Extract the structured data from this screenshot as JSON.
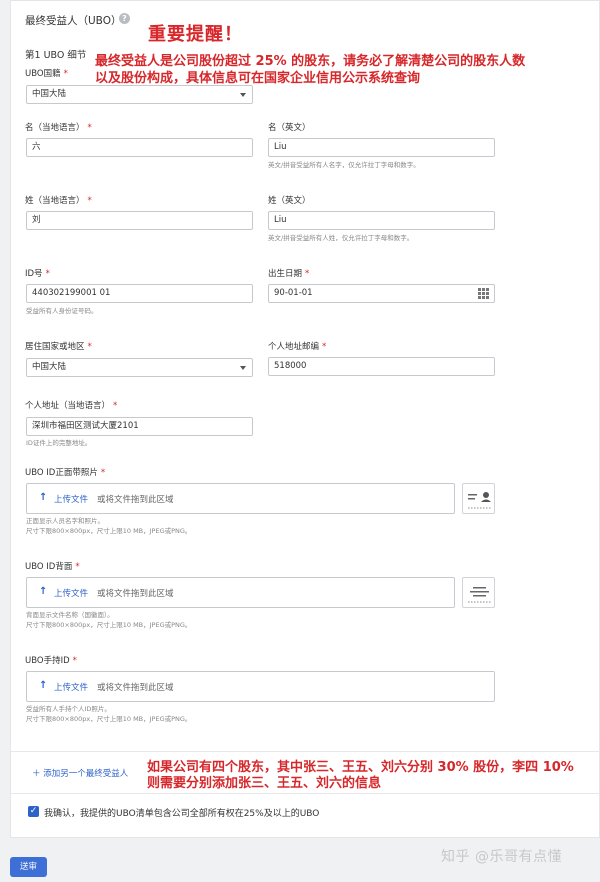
{
  "header": {
    "title": "最终受益人（UBO）",
    "help_icon": "question-circle-icon"
  },
  "notes": {
    "reminder_title": "重要提醒！",
    "reminder_line1": "最终受益人是公司股份超过 25% 的股东，请务必了解清楚公司的股东人数",
    "reminder_line2": "以及股份构成，具体信息可在国家企业信用公示系统查询",
    "example_line1": "如果公司有四个股东，其中张三、王五、刘六分别 30% 股份，李四 10%",
    "example_line2": "则需要分别添加张三、王五、刘六的信息"
  },
  "section": {
    "title": "第1 UBO 细节"
  },
  "form": {
    "nationality": {
      "label": "UBO国籍",
      "value": "中国大陆"
    },
    "given_name_local": {
      "label": "名（当地语言）",
      "value": "六"
    },
    "given_name_en": {
      "label": "名（英文）",
      "value": "Liu",
      "hint": "英文/拼音受益所有人名字，仅允许拉丁字母和数字。"
    },
    "surname_local": {
      "label": "姓（当地语言）",
      "value": "刘"
    },
    "surname_en": {
      "label": "姓（英文）",
      "value": "Liu",
      "hint": "英文/拼音受益所有人姓，仅允许拉丁字母和数字。"
    },
    "id_number": {
      "label": "ID号",
      "value": "440302199001 01",
      "hint": "受益所有人身份证号码。"
    },
    "birth_date": {
      "label": "出生日期",
      "value": "90-01-01",
      "icon": "calendar-icon"
    },
    "residence_country": {
      "label": "居住国家或地区",
      "value": "中国大陆"
    },
    "postal_code": {
      "label": "个人地址邮编",
      "value": "518000"
    },
    "address_local": {
      "label": "个人地址（当地语言）",
      "value": "深圳市福田区测试大厦2101",
      "hint": "ID证件上的完整地址。"
    }
  },
  "uploads": {
    "upload_label": "上传文件",
    "drop_text": "或将文件拖到此区域",
    "front": {
      "label": "UBO ID正面带照片",
      "hint1": "正面显示人员名字和照片。",
      "hint2": "尺寸下限800×800px，尺寸上限10 MB，JPEG或PNG。"
    },
    "back": {
      "label": "UBO ID背面",
      "hint1": "背面显示文件名称（国徽面）。",
      "hint2": "尺寸下限800×800px，尺寸上限10 MB，JPEG或PNG。"
    },
    "holding": {
      "label": "UBO手持ID",
      "hint1": "受益所有人手持个人ID照片。",
      "hint2": "尺寸下限800×800px，尺寸上限10 MB，JPEG或PNG。"
    }
  },
  "actions": {
    "add_label": "添加另一个最终受益人",
    "confirm_text": "我确认，我提供的UBO清单包含公司全部所有权在25%及以上的UBO",
    "submit_label": "送审"
  },
  "watermark": "知乎 @乐哥有点懂",
  "colors": {
    "accent": "#2d62c8",
    "note_red": "#d7272a",
    "required": "#d7272a"
  }
}
